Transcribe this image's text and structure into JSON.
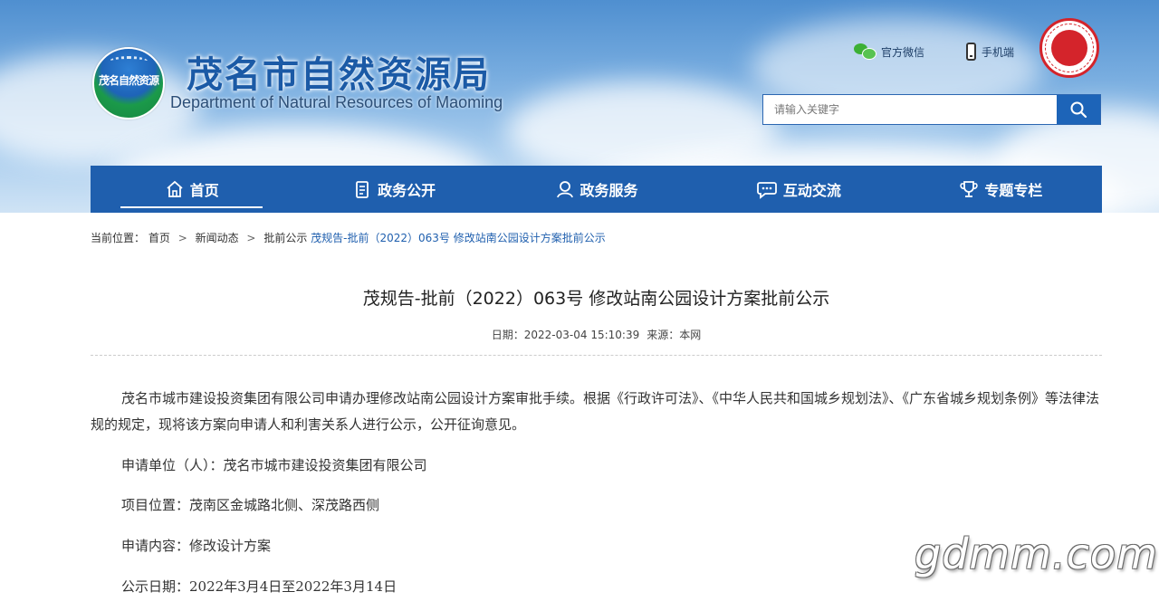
{
  "header": {
    "logo_text": "茂名自然资源",
    "title": "茂名市自然资源局",
    "subtitle": "Department of Natural Resources of Maoming",
    "wechat_label": "官方微信",
    "mobile_label": "手机端",
    "search": {
      "placeholder": "请输入关键字"
    }
  },
  "nav": {
    "items": [
      {
        "label": "首页",
        "icon": "home-icon",
        "active": true
      },
      {
        "label": "政务公开",
        "icon": "document-icon"
      },
      {
        "label": "政务服务",
        "icon": "service-icon"
      },
      {
        "label": "互动交流",
        "icon": "chat-icon"
      },
      {
        "label": "专题专栏",
        "icon": "trophy-icon"
      }
    ]
  },
  "breadcrumb": {
    "prefix": "当前位置：",
    "items": [
      "首页",
      "新闻动态",
      "批前公示"
    ],
    "separator": ">",
    "current": "茂规告-批前（2022）063号 修改站南公园设计方案批前公示"
  },
  "article": {
    "title": "茂规告-批前（2022）063号 修改站南公园设计方案批前公示",
    "date": "日期：2022-03-04 15:10:39",
    "source": "来源：本网",
    "paragraph1": "茂名市城市建设投资集团有限公司申请办理修改站南公园设计方案审批手续。根据《行政许可法》、《中华人民共和国城乡规划法》、《广东省城乡规划条例》等法律法规的规定，现将该方案向申请人和利害关系人进行公示，公开征询意见。",
    "applicant": "申请单位（人）：茂名市城市建设投资集团有限公司",
    "location": "项目位置：茂南区金城路北侧、深茂路西侧",
    "content": "申请内容：修改设计方案",
    "period": "公示日期：2022年3月4日至2022年3月14日"
  },
  "watermark": "gdmm.com",
  "colors": {
    "nav_bg": "#1f5fae",
    "title_blue": "#1b5aa6",
    "emblem_red": "#d4242b"
  }
}
